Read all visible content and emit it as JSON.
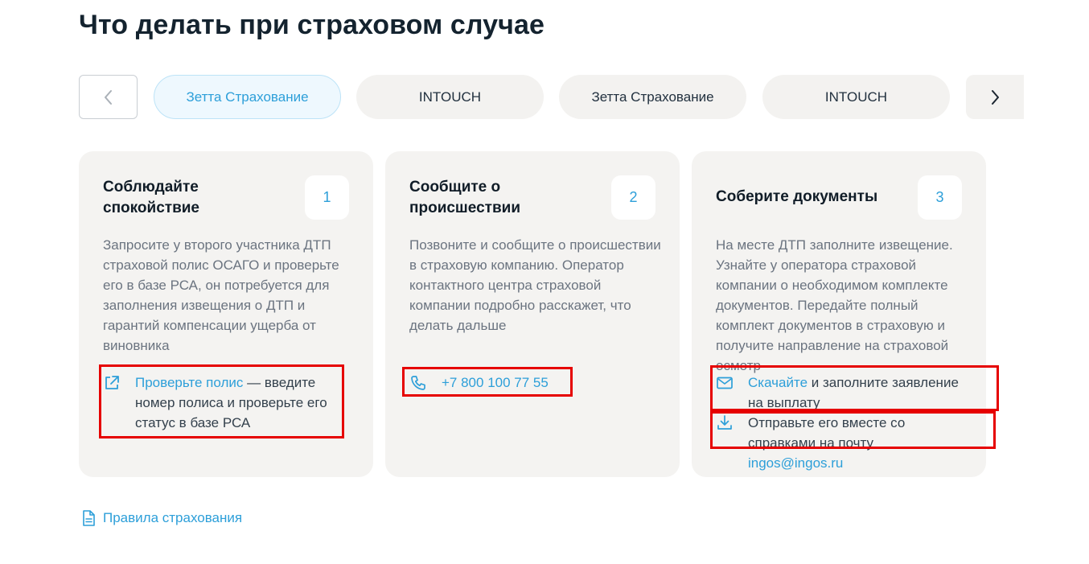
{
  "page_title": "Что делать при страховом случае",
  "tabs": [
    {
      "label": "Зетта Страхование",
      "active": true
    },
    {
      "label": "INTOUCH",
      "active": false
    },
    {
      "label": "Зетта Страхование",
      "active": false
    },
    {
      "label": "INTOUCH",
      "active": false
    }
  ],
  "nav": {
    "prev_icon": "chevron-left-icon",
    "next_icon": "chevron-right-icon"
  },
  "cards": [
    {
      "title": "Соблюдайте спокойствие",
      "number": "1",
      "description": "Запросите у второго участника ДТП страховой полис ОСАГО и проверьте его в базе РСА, он потребуется для заполнения извещения о ДТП и гарантий компенсации ущерба от виновника",
      "link_text": "Проверьте полис",
      "link_suffix": " — введите номер полиса и проверьте его статус в базе РСА",
      "icon": "external-link-icon"
    },
    {
      "title": "Сообщите о происшествии",
      "number": "2",
      "description": "Позвоните и сообщите о происшествии в страховую компанию. Оператор контактного центра страховой компании подробно расскажет, что делать дальше",
      "phone": "+7 800 100 77 55",
      "icon": "phone-icon"
    },
    {
      "title": "Соберите документы",
      "number": "3",
      "description": "На месте ДТП заполните извещение. Узнайте у оператора страховой компании о необходимом комплекте документов. Передайте полный комплект документов в страховую и получите направление на страховой осмотр",
      "download_link": "Скачайте",
      "download_suffix": " и заполните заявление на выплату",
      "send_prefix": "Отправьте его вместе со справками на почту ",
      "email": "ingos@ingos.ru",
      "icons": [
        "mail-icon",
        "download-icon"
      ]
    }
  ],
  "footer": {
    "rules_link": "Правила страхования",
    "icon": "document-icon"
  },
  "colors": {
    "accent": "#2d9fd9",
    "card_bg": "#f4f3f1",
    "highlight": "#e60000"
  }
}
